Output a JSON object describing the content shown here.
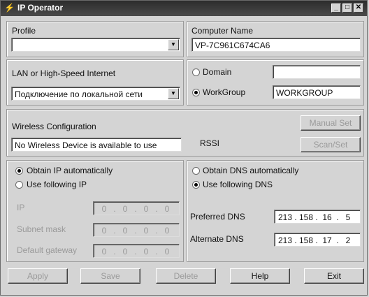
{
  "window": {
    "title": "IP Operator",
    "min": "_",
    "max": "□",
    "close": "✕"
  },
  "profile": {
    "label": "Profile",
    "value": ""
  },
  "computer_name": {
    "label": "Computer Name",
    "value": "VP-7C961C674CA6"
  },
  "lan": {
    "label": "LAN or High-Speed Internet",
    "value": "Подключение по локальной сети"
  },
  "membership": {
    "domain_label": "Domain",
    "domain_value": "",
    "workgroup_label": "WorkGroup",
    "workgroup_value": "WORKGROUP",
    "selected": "workgroup"
  },
  "wireless": {
    "label": "Wireless Configuration",
    "status": "No Wireless Device is available to use",
    "rssi_label": "RSSI",
    "manual_set": "Manual Set",
    "scan_set": "Scan/Set"
  },
  "ip": {
    "obtain_auto_label": "Obtain IP automatically",
    "use_following_label": "Use following IP",
    "selected": "auto",
    "fields": [
      {
        "label": "IP",
        "octets": [
          "0",
          "0",
          "0",
          "0"
        ]
      },
      {
        "label": "Subnet mask",
        "octets": [
          "0",
          "0",
          "0",
          "0"
        ]
      },
      {
        "label": "Default gateway",
        "octets": [
          "0",
          "0",
          "0",
          "0"
        ]
      }
    ]
  },
  "dns": {
    "obtain_auto_label": "Obtain DNS automatically",
    "use_following_label": "Use following DNS",
    "selected": "following",
    "preferred": {
      "label": "Preferred DNS",
      "octets": [
        "213",
        "158",
        "16",
        "5"
      ]
    },
    "alternate": {
      "label": "Alternate DNS",
      "octets": [
        "213",
        "158",
        "17",
        "2"
      ]
    }
  },
  "buttons": {
    "apply": "Apply",
    "save": "Save",
    "delete": "Delete",
    "help": "Help",
    "exit": "Exit"
  }
}
